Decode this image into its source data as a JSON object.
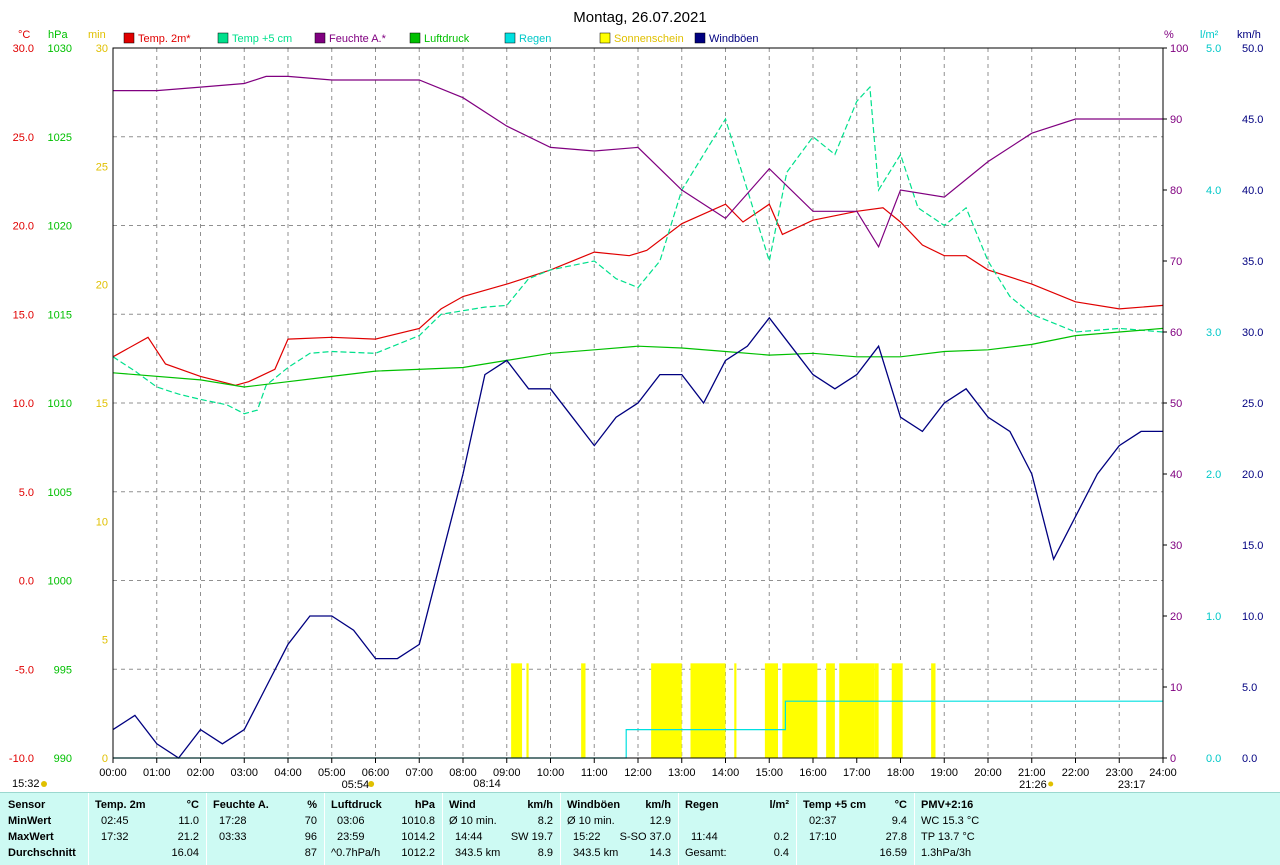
{
  "title": "Montag, 26.07.2021",
  "legend": [
    {
      "label": "Temp. 2m*",
      "color": "#e00000"
    },
    {
      "label": "Temp +5 cm",
      "color": "#00e08c"
    },
    {
      "label": "Feuchte A.*",
      "color": "#800080"
    },
    {
      "label": "Luftdruck",
      "color": "#00c000"
    },
    {
      "label": "Regen",
      "color": "#00e0e0"
    },
    {
      "label": "Sonnenschein",
      "color": "#ffff00"
    },
    {
      "label": "Windböen",
      "color": "#000080"
    }
  ],
  "axis_units": {
    "temp": "°C",
    "pressure": "hPa",
    "sun": "min",
    "humidity": "%",
    "rain": "l/m²",
    "wind": "km/h"
  },
  "axis_ticks": {
    "temp": [
      "30.0",
      "25.0",
      "20.0",
      "15.0",
      "10.0",
      "5.0",
      "0.0",
      "-5.0",
      "-10.0"
    ],
    "pressure": [
      "1030",
      "1025",
      "1020",
      "1015",
      "1010",
      "1005",
      "1000",
      "995",
      "990"
    ],
    "sun": [
      "30",
      "25",
      "20",
      "15",
      "10",
      "5",
      "0"
    ],
    "humidity": [
      "100",
      "90",
      "80",
      "70",
      "60",
      "50",
      "40",
      "30",
      "20",
      "10",
      "0"
    ],
    "rain": [
      "5.0",
      "4.0",
      "3.0",
      "2.0",
      "1.0",
      "0.0"
    ],
    "wind": [
      "50.0",
      "45.0",
      "40.0",
      "35.0",
      "30.0",
      "25.0",
      "20.0",
      "15.0",
      "10.0",
      "5.0",
      "0.0"
    ],
    "time": [
      "00:00",
      "01:00",
      "02:00",
      "03:00",
      "04:00",
      "05:00",
      "06:00",
      "07:00",
      "08:00",
      "09:00",
      "10:00",
      "11:00",
      "12:00",
      "13:00",
      "14:00",
      "15:00",
      "16:00",
      "17:00",
      "18:00",
      "19:00",
      "20:00",
      "21:00",
      "22:00",
      "23:00",
      "24:00"
    ]
  },
  "events": {
    "bottom_left": "15:32",
    "sunrise": "05:54",
    "temp_event": "08:14",
    "sunset": "21:26",
    "rain_event": "23:17"
  },
  "chart_data": {
    "type": "line",
    "title": "Montag, 26.07.2021",
    "x_unit": "hour of day",
    "xlim": [
      0,
      24
    ],
    "ylim_temp": [
      -10,
      30
    ],
    "ylim_pressure": [
      990,
      1030
    ],
    "ylim_sun": [
      0,
      30
    ],
    "ylim_humidity": [
      0,
      100
    ],
    "ylim_rain": [
      0,
      5
    ],
    "ylim_wind": [
      0,
      50
    ],
    "series": [
      {
        "name": "Temp. 2m*",
        "axis": "temp",
        "color": "#e00000",
        "points": [
          [
            0,
            12.6
          ],
          [
            0.8,
            13.7
          ],
          [
            1.2,
            12.2
          ],
          [
            2,
            11.5
          ],
          [
            2.8,
            11.0
          ],
          [
            3.1,
            11.2
          ],
          [
            3.7,
            11.9
          ],
          [
            4,
            13.6
          ],
          [
            5,
            13.7
          ],
          [
            6,
            13.6
          ],
          [
            7,
            14.2
          ],
          [
            7.5,
            15.3
          ],
          [
            8,
            16.0
          ],
          [
            9,
            16.7
          ],
          [
            10,
            17.5
          ],
          [
            11,
            18.5
          ],
          [
            11.8,
            18.3
          ],
          [
            12.2,
            18.6
          ],
          [
            13,
            20.1
          ],
          [
            14,
            21.2
          ],
          [
            14.4,
            20.2
          ],
          [
            15,
            21.2
          ],
          [
            15.3,
            19.5
          ],
          [
            16,
            20.3
          ],
          [
            17,
            20.8
          ],
          [
            17.6,
            21.0
          ],
          [
            18,
            20.2
          ],
          [
            18.5,
            18.9
          ],
          [
            19,
            18.3
          ],
          [
            19.5,
            18.3
          ],
          [
            20,
            17.5
          ],
          [
            21,
            16.7
          ],
          [
            22,
            15.7
          ],
          [
            23,
            15.3
          ],
          [
            24,
            15.5
          ]
        ]
      },
      {
        "name": "Temp +5 cm",
        "axis": "temp",
        "color": "#00e08c",
        "points": [
          [
            0,
            12.6
          ],
          [
            0.5,
            11.8
          ],
          [
            1,
            10.9
          ],
          [
            1.5,
            10.5
          ],
          [
            2,
            10.2
          ],
          [
            2.6,
            9.9
          ],
          [
            3,
            9.4
          ],
          [
            3.3,
            9.6
          ],
          [
            3.5,
            11.0
          ],
          [
            4,
            12.0
          ],
          [
            4.5,
            12.8
          ],
          [
            5,
            12.9
          ],
          [
            6,
            12.8
          ],
          [
            7,
            13.8
          ],
          [
            7.5,
            15.0
          ],
          [
            8,
            15.2
          ],
          [
            8.5,
            15.4
          ],
          [
            9,
            15.5
          ],
          [
            9.5,
            17.0
          ],
          [
            10,
            17.5
          ],
          [
            11,
            18.0
          ],
          [
            11.5,
            17.0
          ],
          [
            12,
            16.5
          ],
          [
            12.5,
            18.0
          ],
          [
            13,
            22.0
          ],
          [
            13.5,
            24.0
          ],
          [
            14,
            26.0
          ],
          [
            14.5,
            22.0
          ],
          [
            15,
            18.0
          ],
          [
            15.4,
            23.0
          ],
          [
            16,
            25.0
          ],
          [
            16.5,
            24.0
          ],
          [
            17,
            27.0
          ],
          [
            17.3,
            27.8
          ],
          [
            17.5,
            22.0
          ],
          [
            18,
            24.0
          ],
          [
            18.4,
            21.0
          ],
          [
            19,
            20.0
          ],
          [
            19.5,
            21.0
          ],
          [
            20,
            18.0
          ],
          [
            20.5,
            16.0
          ],
          [
            21,
            15.0
          ],
          [
            22,
            14.0
          ],
          [
            23,
            14.2
          ],
          [
            24,
            14.0
          ]
        ]
      },
      {
        "name": "Feuchte A.*",
        "axis": "humidity",
        "color": "#800080",
        "points": [
          [
            0,
            94
          ],
          [
            1,
            94
          ],
          [
            2,
            94.5
          ],
          [
            3,
            95
          ],
          [
            3.5,
            96
          ],
          [
            4,
            96
          ],
          [
            5,
            95.5
          ],
          [
            6,
            95.5
          ],
          [
            7,
            95.5
          ],
          [
            8,
            93
          ],
          [
            9,
            89
          ],
          [
            10,
            86
          ],
          [
            11,
            85.5
          ],
          [
            12,
            86
          ],
          [
            13,
            80
          ],
          [
            14,
            76
          ],
          [
            15,
            83
          ],
          [
            16,
            77
          ],
          [
            17,
            77
          ],
          [
            17.5,
            72
          ],
          [
            18,
            80
          ],
          [
            19,
            79
          ],
          [
            20,
            84
          ],
          [
            21,
            88
          ],
          [
            22,
            90
          ],
          [
            23,
            90
          ],
          [
            24,
            90
          ]
        ]
      },
      {
        "name": "Luftdruck",
        "axis": "pressure",
        "color": "#00c000",
        "points": [
          [
            0,
            1011.7
          ],
          [
            2,
            1011.3
          ],
          [
            3,
            1010.9
          ],
          [
            4,
            1011.2
          ],
          [
            5,
            1011.5
          ],
          [
            6,
            1011.8
          ],
          [
            8,
            1012.0
          ],
          [
            9,
            1012.4
          ],
          [
            10,
            1012.8
          ],
          [
            11,
            1013.0
          ],
          [
            12,
            1013.2
          ],
          [
            13,
            1013.1
          ],
          [
            14,
            1012.9
          ],
          [
            15,
            1012.7
          ],
          [
            16,
            1012.8
          ],
          [
            17,
            1012.6
          ],
          [
            18,
            1012.6
          ],
          [
            19,
            1012.9
          ],
          [
            20,
            1013.0
          ],
          [
            21,
            1013.3
          ],
          [
            22,
            1013.8
          ],
          [
            23,
            1014.0
          ],
          [
            24,
            1014.2
          ]
        ]
      },
      {
        "name": "Windböen",
        "axis": "wind",
        "color": "#000080",
        "points": [
          [
            0,
            2
          ],
          [
            0.5,
            3
          ],
          [
            1,
            1
          ],
          [
            1.5,
            0
          ],
          [
            2,
            2
          ],
          [
            2.5,
            1
          ],
          [
            3,
            2
          ],
          [
            3.5,
            5
          ],
          [
            4,
            8
          ],
          [
            4.5,
            10
          ],
          [
            5,
            10
          ],
          [
            5.5,
            9
          ],
          [
            6,
            7
          ],
          [
            6.5,
            7
          ],
          [
            7,
            8
          ],
          [
            7.5,
            14
          ],
          [
            8,
            20
          ],
          [
            8.5,
            27
          ],
          [
            9,
            28
          ],
          [
            9.5,
            26
          ],
          [
            10,
            26
          ],
          [
            10.5,
            24
          ],
          [
            11,
            22
          ],
          [
            11.5,
            24
          ],
          [
            12,
            25
          ],
          [
            12.5,
            27
          ],
          [
            13,
            27
          ],
          [
            13.5,
            25
          ],
          [
            14,
            28
          ],
          [
            14.5,
            29
          ],
          [
            15,
            31
          ],
          [
            15.5,
            29
          ],
          [
            16,
            27
          ],
          [
            16.5,
            26
          ],
          [
            17,
            27
          ],
          [
            17.5,
            29
          ],
          [
            18,
            24
          ],
          [
            18.5,
            23
          ],
          [
            19,
            25
          ],
          [
            19.5,
            26
          ],
          [
            20,
            24
          ],
          [
            20.5,
            23
          ],
          [
            21,
            20
          ],
          [
            21.5,
            14
          ],
          [
            22,
            17
          ],
          [
            22.5,
            20
          ],
          [
            23,
            22
          ],
          [
            23.5,
            23
          ],
          [
            24,
            23
          ]
        ]
      },
      {
        "name": "Regen",
        "axis": "rain",
        "color": "#00e0e0",
        "points": [
          [
            0,
            0
          ],
          [
            11.73,
            0
          ],
          [
            11.73,
            0.2
          ],
          [
            15.37,
            0.2
          ],
          [
            15.37,
            0.4
          ],
          [
            24,
            0.4
          ]
        ]
      }
    ],
    "sunshine": {
      "axis": "sun",
      "color": "#ffff00",
      "intervals": [
        [
          9.1,
          9.35
        ],
        [
          9.45,
          9.5
        ],
        [
          10.7,
          10.8
        ],
        [
          12.3,
          13.0
        ],
        [
          13.2,
          14.0
        ],
        [
          14.2,
          14.25
        ],
        [
          14.9,
          15.2
        ],
        [
          15.3,
          16.1
        ],
        [
          16.3,
          16.5
        ],
        [
          16.6,
          17.4
        ],
        [
          17.4,
          17.5
        ],
        [
          17.8,
          18.05
        ],
        [
          18.7,
          18.8
        ]
      ]
    }
  },
  "stats": {
    "headers": {
      "sensor": "Sensor",
      "temp": "Temp. 2m",
      "temp_unit": "°C",
      "hum": "Feuchte A.",
      "hum_unit": "%",
      "press": "Luftdruck",
      "press_unit": "hPa",
      "wind": "Wind",
      "wind_unit": "km/h",
      "gust": "Windböen",
      "gust_unit": "km/h",
      "rain": "Regen",
      "rain_unit": "l/m²",
      "t5": "Temp +5 cm",
      "t5_unit": "°C",
      "pmv": "PMV+2:16"
    },
    "rows": {
      "min": "MinWert",
      "max": "MaxWert",
      "avg": "Durchschnitt"
    },
    "temp": {
      "min_time": "02:45",
      "min": "11.0",
      "max_time": "17:32",
      "max": "21.2",
      "avg": "16.04"
    },
    "hum": {
      "min_time": "17:28",
      "min": "70",
      "max_time": "03:33",
      "max": "96",
      "avg": "87"
    },
    "press": {
      "min_time": "03:06",
      "min": "1010.8",
      "max_time": "23:59",
      "max": "1014.2",
      "trend": "^0.7hPa/h",
      "avg": "1012.2"
    },
    "wind": {
      "r1_label": "Ø 10 min.",
      "r1_val": "8.2",
      "r2_time": "14:44",
      "r2_dir": "SW 19.7",
      "r3_label": "343.5 km",
      "r3_val": "8.9"
    },
    "gust": {
      "r1_label": "Ø 10 min.",
      "r1_val": "12.9",
      "r2_time": "15:22",
      "r2_dir": "S-SO 37.0",
      "r3_label": "343.5 km",
      "r3_val": "14.3"
    },
    "rain": {
      "r2_time": "11:44",
      "r2_val": "0.2",
      "r3_label": "Gesamt:",
      "r3_val": "0.4"
    },
    "t5": {
      "min_time": "02:37",
      "min": "9.4",
      "max_time": "17:10",
      "max": "27.8",
      "avg": "16.59"
    },
    "pmv": {
      "r1": "WC 15.3 °C",
      "r2": "TP 13.7 °C",
      "r3": "1.3hPa/3h"
    }
  }
}
